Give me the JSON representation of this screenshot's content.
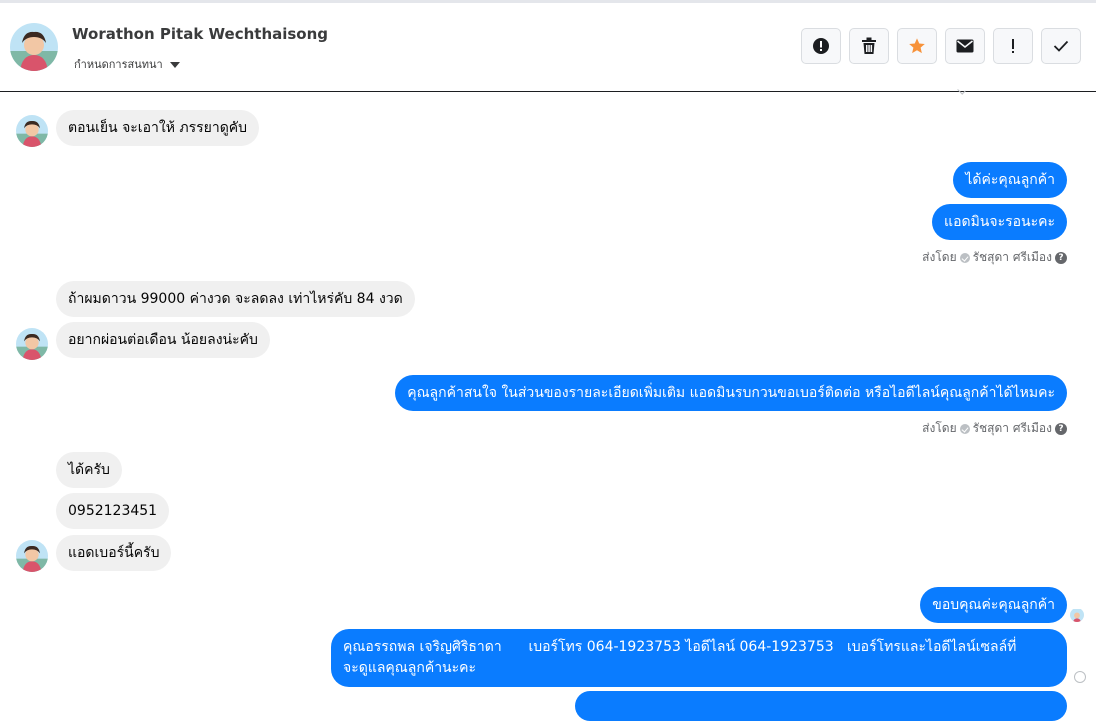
{
  "header": {
    "contact_name": "Worathon Pitak Wechthaisong",
    "subtitle": "กำหนดการสนทนา",
    "toolbar": [
      {
        "name": "alert-circle-button",
        "icon": "exclamation-circle-icon"
      },
      {
        "name": "delete-button",
        "icon": "trash-icon"
      },
      {
        "name": "star-button",
        "icon": "star-icon",
        "color": "#f7923a"
      },
      {
        "name": "mark-unread-button",
        "icon": "envelope-icon"
      },
      {
        "name": "important-button",
        "icon": "exclamation-icon"
      },
      {
        "name": "done-button",
        "icon": "check-icon"
      }
    ]
  },
  "messages": {
    "m1": "ตอนเย็น จะเอาให้ ภรรยาดูคับ",
    "m2": "ได้ค่ะคุณลูกค้า",
    "m3": "แอดมินจะรอนะคะ",
    "sent_by_1": {
      "prefix": "ส่งโดย",
      "agent": "รัชสุดา ศรีเมือง"
    },
    "m4": "ถ้าผมดาวน 99000  ค่างวด จะลดลง เท่าไหร่คับ 84 งวด",
    "m5": "อยากผ่อนต่อเดือน น้อยลงน่ะคับ",
    "m6": "คุณลูกค้าสนใจ ในส่วนของรายละเอียดเพิ่มเติม แอดมินรบกวนขอเบอร์ติดต่อ หรือไอดีไลน์คุณลูกค้าได้ไหมคะ",
    "sent_by_2": {
      "prefix": "ส่งโดย",
      "agent": "รัชสุดา ศรีเมือง"
    },
    "m7": "ได้ครับ",
    "m8": "0952123451",
    "m9": "แอดเบอร์นี้ครับ",
    "m10": "ขอบคุณค่ะคุณลูกค้า",
    "m11_line1": "คุณอรรถพล เจริญศิริธาดา      เบอร์โทร 064-1923753 ไอดีไลน์ 064-1923753   เบอร์โทรและไอดีไลน์เซลล์ที่",
    "m11_line2": "จะดูแลคุณลูกค้านะคะ"
  },
  "colors": {
    "outgoing_bubble": "#0a7cff",
    "incoming_bubble": "#f0f0f0",
    "meta_text": "#65676b"
  }
}
